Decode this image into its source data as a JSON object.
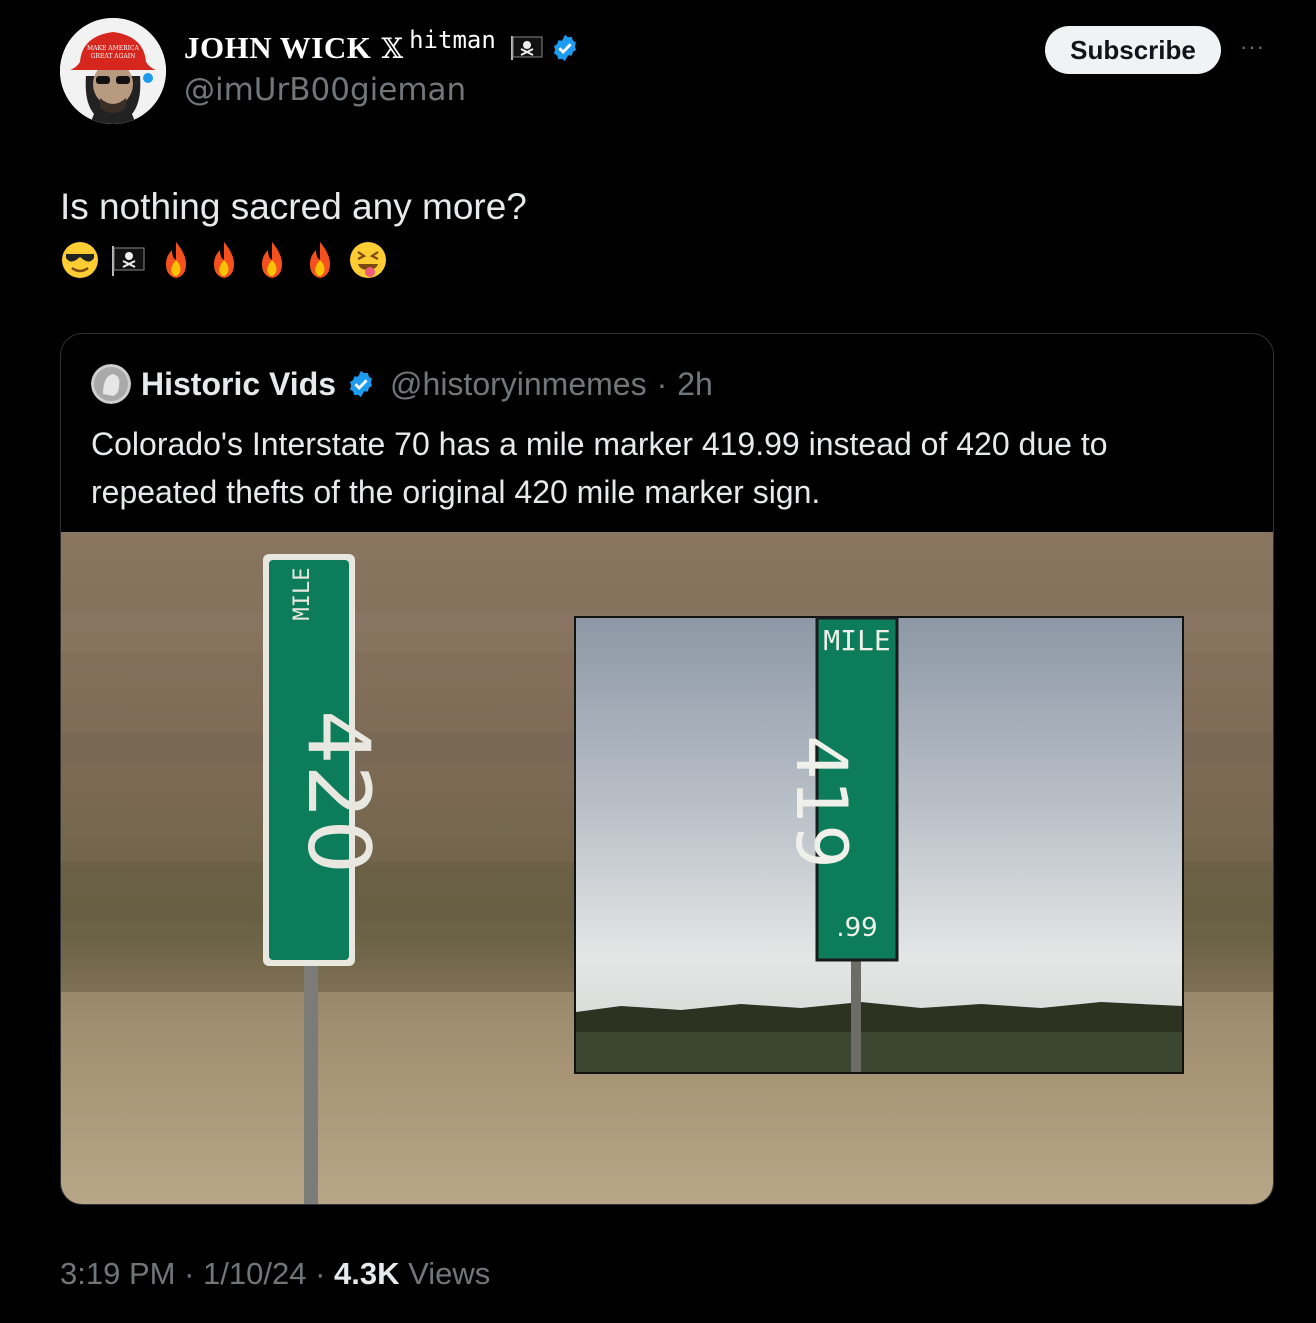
{
  "author": {
    "display_name": "JOHN WICK",
    "name_suffix_x": "𝕏",
    "name_suffix_text": "hitman",
    "handle": "@imUrB00gieman",
    "avatar_hat_text": "MAKE AMERICA GREAT AGAIN"
  },
  "actions": {
    "subscribe_label": "Subscribe",
    "more_label": "···"
  },
  "post": {
    "text": "Is nothing sacred any more?",
    "emojis": [
      "smiling-face-with-sunglasses",
      "pirate-flag",
      "fire",
      "fire",
      "fire",
      "fire",
      "squinting-face-with-tongue"
    ]
  },
  "quote": {
    "name": "Historic Vids",
    "handle": "@historyinmemes",
    "separator": "·",
    "time": "2h",
    "text": "Colorado's Interstate 70 has a mile marker 419.99 instead of 420 due to repeated thefts of the original 420 mile marker sign.",
    "image": {
      "sign_left_label": "MILE",
      "sign_left_number": "420",
      "sign_right_label": "MILE",
      "sign_right_number": "419",
      "sign_right_decimal": ".99"
    }
  },
  "meta": {
    "time": "3:19 PM",
    "sep": " · ",
    "date": "1/10/24",
    "views_count": "4.3K",
    "views_label": " Views"
  },
  "colors": {
    "accent_verified": "#1d9bf0",
    "sign_green": "#0c7c5a",
    "background": "#000000"
  }
}
